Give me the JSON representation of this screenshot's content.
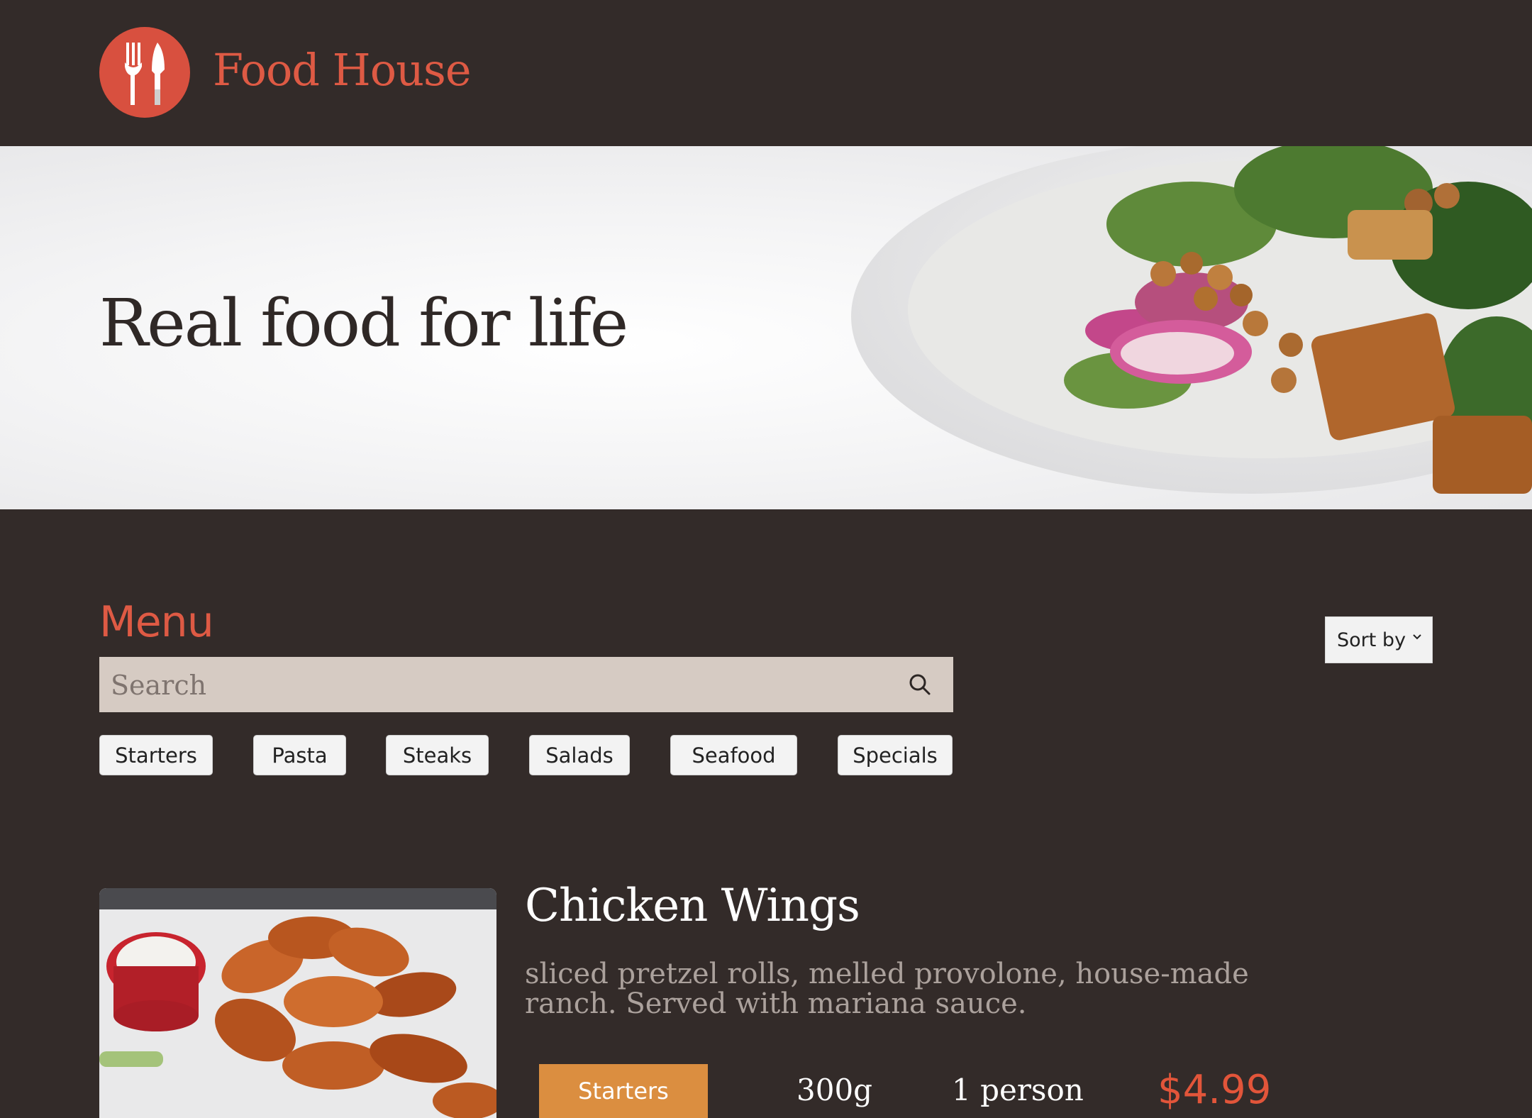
{
  "header": {
    "brand": "Food House",
    "logo_icon": "fork-knife-icon"
  },
  "hero": {
    "title": "Real food for life"
  },
  "menu": {
    "title": "Menu",
    "search": {
      "placeholder": "Search",
      "icon": "search-icon"
    },
    "sort": {
      "label": "Sort by",
      "icon": "chevron-down-icon"
    },
    "categories": [
      "Starters",
      "Pasta",
      "Steaks",
      "Salads",
      "Seafood",
      "Specials"
    ]
  },
  "items": [
    {
      "name": "Chicken Wings",
      "description": "sliced pretzel rolls, melled provolone, house-made ranch. Served with mariana sauce.",
      "category": "Starters",
      "weight": "300g",
      "serves": "1 person",
      "price": "$4.99"
    }
  ],
  "colors": {
    "background": "#332b29",
    "accent": "#de5a44",
    "search_bg": "#d6cbc3",
    "category_button": "#db8e40",
    "price": "#e2553a"
  }
}
